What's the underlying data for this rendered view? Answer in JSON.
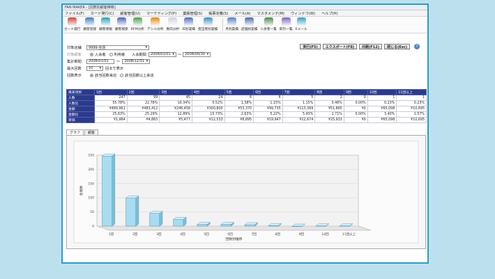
{
  "window_title": "FAN MAKER - [回数別顧客推移]",
  "menu": [
    "ファイル(F)",
    "カード発行(C)",
    "顧客管理(U)",
    "マーケティング(P)",
    "業績管理(S)",
    "帳票定義(S)",
    "メール(A)",
    "マスタメンテ(M)",
    "ウィンドウ(W)",
    "ヘルプ(H)"
  ],
  "toolbar": [
    {
      "label": "カード発行",
      "icon": "card-issue-icon",
      "color": "#c84a3c"
    },
    {
      "label": "顧客登録",
      "icon": "customer-register-icon",
      "color": "#3f7cc8"
    },
    {
      "label": "顧客情報",
      "icon": "customer-info-icon",
      "color": "#2a9fb5"
    },
    {
      "label": "顧客検索",
      "icon": "customer-search-icon",
      "color": "#4a64c0"
    },
    {
      "label": "RFM分析",
      "icon": "rfm-analysis-icon",
      "color": "#4aa04a"
    },
    {
      "label": "デシル分析",
      "icon": "decile-analysis-icon",
      "color": "#e08a1e"
    },
    {
      "label": "数向分析",
      "icon": "trend-analysis-icon",
      "color": "#d0d4dc"
    },
    {
      "label": "日別実績",
      "icon": "daily-results-icon",
      "color": "#4d6fb8"
    },
    {
      "label": "担当者別実績",
      "icon": "staff-results-icon",
      "color": "#3a8ec8"
    },
    {
      "label": "月別実績",
      "icon": "monthly-results-icon",
      "color": "#5a7ec4"
    },
    {
      "label": "店舗別実績",
      "icon": "store-results-icon",
      "color": "#4a6cb0"
    },
    {
      "label": "入会者一覧",
      "icon": "member-list-icon",
      "color": "#4a8a4a"
    },
    {
      "label": "取引一覧",
      "icon": "transaction-list-icon",
      "color": "#7a6ab8"
    },
    {
      "label": "Eメール",
      "icon": "email-icon",
      "color": "#3aa0c8"
    }
  ],
  "form": {
    "store_label": "対象店舗",
    "store_value": "9999:全店",
    "target_label": "対象顧客",
    "target_opt1": "入会者",
    "target_opt2": "利用者",
    "join_period_label": "入会期間",
    "join_from": "2008/01/01",
    "join_to": "2008/06/30",
    "tilde": "〜",
    "agg_label": "集計期間",
    "agg_from": "2008/01/01",
    "agg_to": "2008/12/31",
    "max_label": "最大回数",
    "max_value": "10",
    "max_suffix": "回まで表示",
    "visit_label": "回数表示",
    "visit_opt1": "該当回数来店",
    "visit_opt2": "該当回数以上来店",
    "buttons": [
      "実行(F5)",
      "エクスポート(F8)",
      "印刷(F12)",
      "閉じる(Esc)"
    ],
    "help": "?"
  },
  "table": {
    "header": [
      "再来項目",
      "1回",
      "2回",
      "3回",
      "4回",
      "5回",
      "6回",
      "7回",
      "8回",
      "9回",
      "10回",
      "11回以上"
    ],
    "rows": [
      [
        "人数",
        "247",
        "99",
        "45",
        "24",
        "6",
        "6",
        "5",
        "2",
        "0",
        "1",
        "1"
      ],
      [
        "人数比",
        "55.78%",
        "22.78%",
        "10.34%",
        "5.52%",
        "1.38%",
        "1.15%",
        "1.15%",
        "0.46%",
        "0.00%",
        "0.23%",
        "0.23%"
      ],
      [
        "金額",
        "¥489,961",
        "¥483,412",
        "¥246,458",
        "¥300,800",
        "¥53,370",
        "¥99,735",
        "¥113,369",
        "¥51,865",
        "¥0",
        "¥65,098",
        "¥10,695"
      ],
      [
        "金額比",
        "25.63%",
        "25.29%",
        "12.89%",
        "15.73%",
        "2.63%",
        "5.22%",
        "5.93%",
        "2.71%",
        "0.00%",
        "3.40%",
        "1.57%"
      ],
      [
        "単価",
        "¥1,984",
        "¥4,883",
        "¥5,477",
        "¥12,533",
        "¥8,895",
        "¥19,947",
        "¥22,674",
        "¥25,933",
        "¥0",
        "¥65,098",
        "¥10,695"
      ]
    ]
  },
  "tabs": [
    "グラフ",
    "顧客"
  ],
  "chart_data": {
    "type": "bar",
    "categories": [
      "1回",
      "2回",
      "3回",
      "4回",
      "5回",
      "6回",
      "7回",
      "8回",
      "9回",
      "10回",
      "11回以上"
    ],
    "values": [
      247,
      99,
      45,
      24,
      6,
      6,
      5,
      2,
      0,
      1,
      1
    ],
    "ylim": [
      0,
      250
    ],
    "yticks": [
      "0",
      "50",
      "100",
      "150",
      "200",
      "250"
    ],
    "ylabel": "会員数",
    "xlabel": "回数別推移",
    "bar_color": "#a8dcf0",
    "grid": true
  }
}
